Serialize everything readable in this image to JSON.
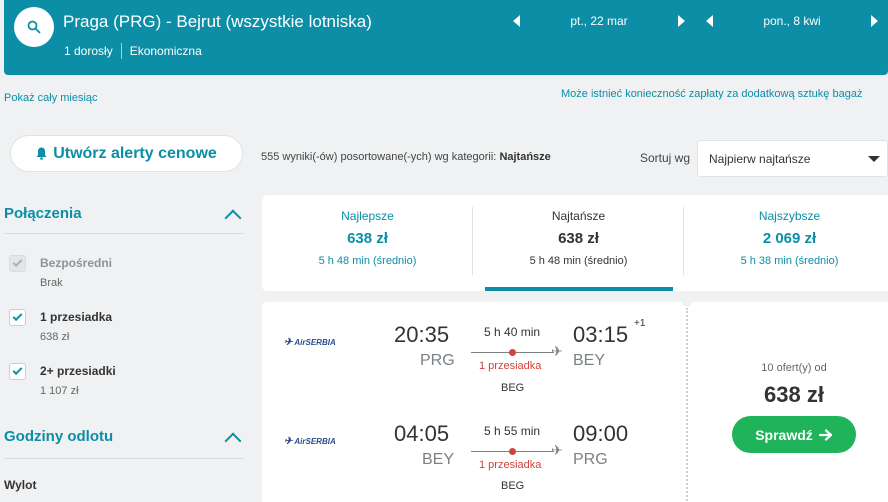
{
  "header": {
    "route": "Praga (PRG) - Bejrut (wszystkie lotniska)",
    "passengers": "1 dorosły",
    "cabin": "Ekonomiczna",
    "depart_date": "pt., 22 mar",
    "return_date": "pon., 8 kwi"
  },
  "links": {
    "whole_month": "Pokaż cały miesiąc",
    "baggage_notice": "Może istnieć konieczność zapłaty za dodatkową sztukę bagaż"
  },
  "alert_button": "Utwórz alerty cenowe",
  "results": {
    "count_text": "555 wyniki(-ów) posortowane(-ych) wg kategorii:",
    "category": "Najtańsze"
  },
  "sort": {
    "label": "Sortuj wg",
    "selected": "Najpierw najtańsze"
  },
  "filters": {
    "connections_title": "Połączenia",
    "options": [
      {
        "label": "Bezpośredni",
        "sub": "Brak",
        "checked": true,
        "disabled": true
      },
      {
        "label": "1 przesiadka",
        "sub": "638 zł",
        "checked": true,
        "disabled": false
      },
      {
        "label": "2+ przesiadki",
        "sub": "1 107 zł",
        "checked": true,
        "disabled": false
      }
    ],
    "departure_times_title": "Godziny odlotu",
    "departure_label": "Wylot"
  },
  "tabs": [
    {
      "label": "Najlepsze",
      "price": "638 zł",
      "time": "5 h 48 min (średnio)"
    },
    {
      "label": "Najtańsze",
      "price": "638 zł",
      "time": "5 h 48 min (średnio)"
    },
    {
      "label": "Najszybsze",
      "price": "2 069 zł",
      "time": "5 h 38 min (średnio)"
    }
  ],
  "result": {
    "outbound": {
      "airline": "AirSERBIA",
      "dep_time": "20:35",
      "dep_code": "PRG",
      "arr_time": "03:15",
      "arr_code": "BEY",
      "day_offset": "+1",
      "duration": "5 h 40 min",
      "stops": "1 przesiadka",
      "via": "BEG"
    },
    "inbound": {
      "airline": "AirSERBIA",
      "dep_time": "04:05",
      "dep_code": "BEY",
      "arr_time": "09:00",
      "arr_code": "PRG",
      "duration": "5 h 55 min",
      "stops": "1 przesiadka",
      "via": "BEG"
    },
    "offers": "10 ofert(y) od",
    "price": "638 zł",
    "button": "Sprawdź"
  },
  "colors": {
    "accent": "#0b8ea6",
    "stop_red": "#d1423b",
    "cta_green": "#1fb35a"
  }
}
